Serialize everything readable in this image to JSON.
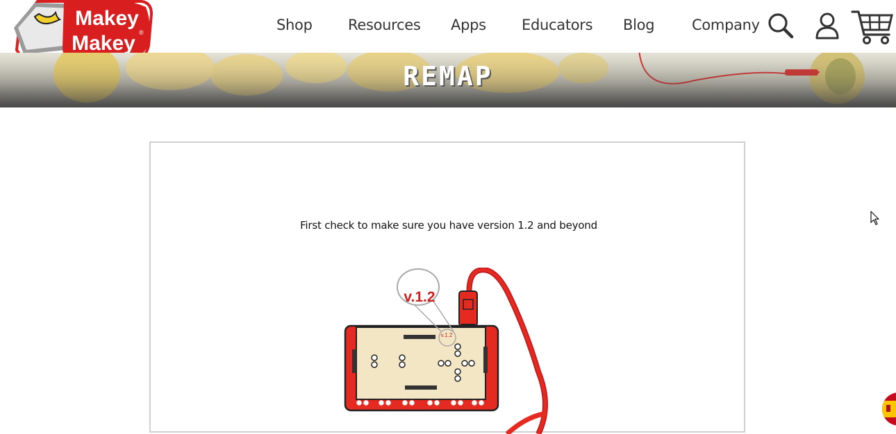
{
  "brand": {
    "logo_text": "Makey Makey",
    "colors": {
      "red": "#e02020",
      "dark": "#333333",
      "cream": "#f3e6c5",
      "gold": "#e4a51d"
    }
  },
  "nav": {
    "items": [
      {
        "label": "Shop"
      },
      {
        "label": "Resources"
      },
      {
        "label": "Apps"
      },
      {
        "label": "Educators"
      },
      {
        "label": "Blog"
      },
      {
        "label": "Company"
      }
    ],
    "icons": [
      "search-icon",
      "account-icon",
      "cart-icon"
    ]
  },
  "banner": {
    "title": "REMAP"
  },
  "main": {
    "intro_text": "First check to make sure you have version 1.2 and beyond",
    "version_label": "v.1.2",
    "version_label_small": "v.1.2"
  },
  "language_flag": "spain-flag-icon"
}
